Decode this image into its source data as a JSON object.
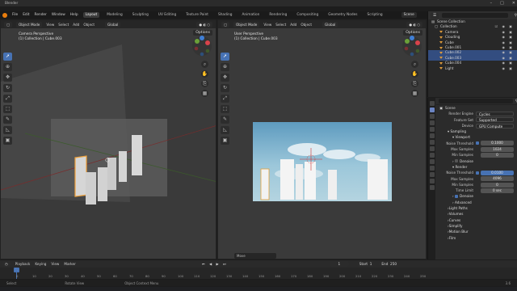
{
  "window": {
    "title": "Blender",
    "controls": [
      "–",
      "□",
      "✕"
    ]
  },
  "topbar": {
    "menus": [
      "File",
      "Edit",
      "Render",
      "Window",
      "Help"
    ],
    "workspaces": [
      "Layout",
      "Modeling",
      "Sculpting",
      "UV Editing",
      "Texture Paint",
      "Shading",
      "Animation",
      "Rendering",
      "Compositing",
      "Geometry Nodes",
      "Scripting"
    ],
    "active_workspace": "Layout",
    "scene": "Scene",
    "view_layer": "ViewLayer"
  },
  "viewport_header": {
    "mode": "Object Mode",
    "menus": [
      "View",
      "Select",
      "Add",
      "Object"
    ],
    "orientation": "Global",
    "options": "Options"
  },
  "left_viewport": {
    "title": "Camera Perspective",
    "subtitle": "(1) Collection | Cube.003"
  },
  "right_viewport": {
    "title": "User Perspective",
    "subtitle": "(1) Collection | Cube.003",
    "move_label": "Move"
  },
  "outliner": {
    "root": "Scene Collection",
    "collection": "Collection",
    "items": [
      {
        "name": "Camera",
        "selected": false
      },
      {
        "name": "Clouding",
        "selected": false
      },
      {
        "name": "Cube",
        "selected": false
      },
      {
        "name": "Cube.001",
        "selected": false
      },
      {
        "name": "Cube.002",
        "selected": true
      },
      {
        "name": "Cube.003",
        "selected": true
      },
      {
        "name": "Cube.004",
        "selected": false
      },
      {
        "name": "Light",
        "selected": false
      }
    ]
  },
  "properties": {
    "scene_label": "Scene",
    "render_engine": {
      "label": "Render Engine",
      "value": "Cycles"
    },
    "feature_set": {
      "label": "Feature Set",
      "value": "Supported"
    },
    "device": {
      "label": "Device",
      "value": "GPU Compute"
    },
    "sampling": "Sampling",
    "viewport": "Viewport",
    "noise_threshold_vp": {
      "label": "Noise Threshold",
      "value": "0.1000"
    },
    "max_samples_vp": {
      "label": "Max Samples",
      "value": "1024"
    },
    "min_samples_vp": {
      "label": "Min Samples",
      "value": "0"
    },
    "denoise_vp": "Denoise",
    "render": "Render",
    "noise_threshold_r": {
      "label": "Noise Threshold",
      "value": "0.0100"
    },
    "max_samples_r": {
      "label": "Max Samples",
      "value": "4096"
    },
    "min_samples_r": {
      "label": "Min Samples",
      "value": "0"
    },
    "time_limit": {
      "label": "Time Limit",
      "value": "0 sec"
    },
    "denoise_r": "Denoise",
    "advanced": "Advanced",
    "sections": [
      "Light Paths",
      "Volumes",
      "Curves",
      "Simplify",
      "Motion Blur",
      "Film"
    ]
  },
  "timeline": {
    "menus": [
      "Playback",
      "Keying",
      "View",
      "Marker"
    ],
    "current_frame": "1",
    "start_label": "Start",
    "start": "1",
    "end_label": "End",
    "end": "250",
    "ticks": [
      "0",
      "10",
      "20",
      "30",
      "40",
      "50",
      "60",
      "70",
      "80",
      "90",
      "100",
      "110",
      "120",
      "130",
      "140",
      "150",
      "160",
      "170",
      "180",
      "190",
      "200",
      "210",
      "220",
      "230",
      "240",
      "250"
    ]
  },
  "statusbar": {
    "left": "Select",
    "middle": "Rotate View",
    "right": "Object Context Menu",
    "version": "3.6"
  }
}
